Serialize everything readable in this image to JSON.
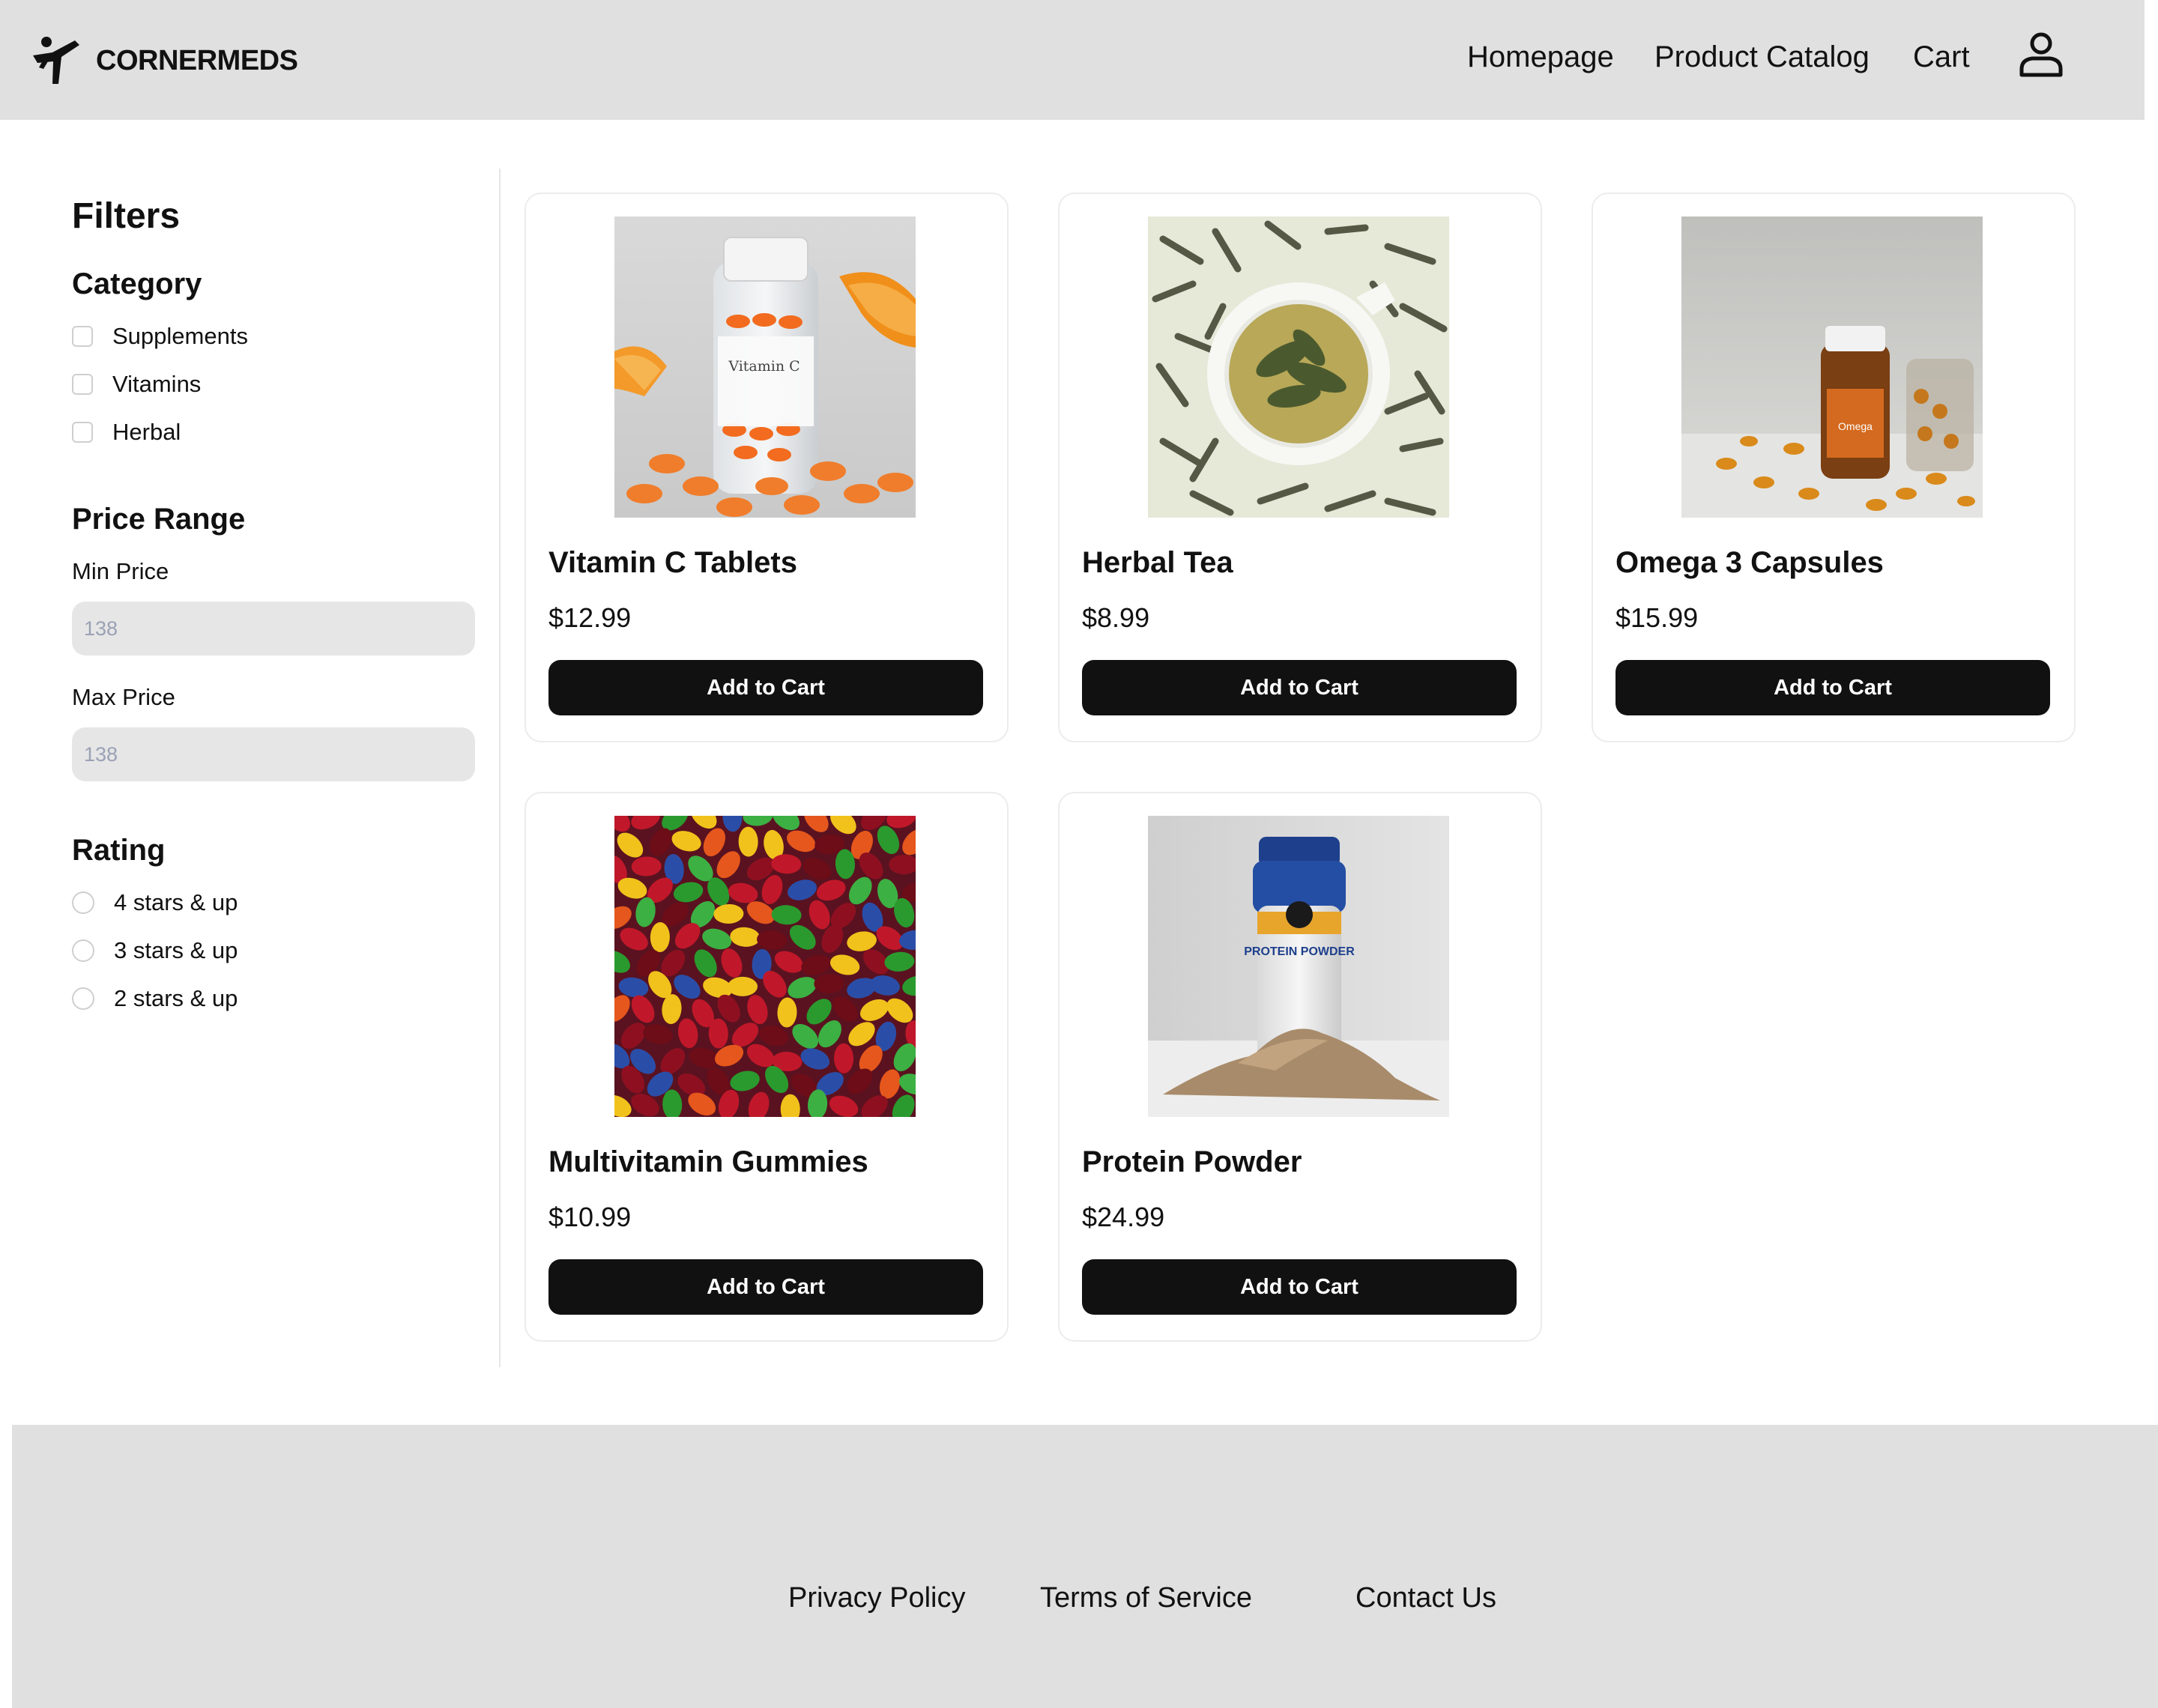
{
  "header": {
    "brand": "CORNERMEDS",
    "logo_icon": "runner-logo-icon",
    "nav": [
      "Homepage",
      "Product Catalog",
      "Cart"
    ],
    "user_icon": "user-icon"
  },
  "filters": {
    "title": "Filters",
    "category": {
      "title": "Category",
      "options": [
        "Supplements",
        "Vitamins",
        "Herbal"
      ]
    },
    "price_range": {
      "title": "Price Range",
      "min_label": "Min Price",
      "min_placeholder": "138",
      "max_label": "Max Price",
      "max_placeholder": "138"
    },
    "rating": {
      "title": "Rating",
      "options": [
        "4 stars & up",
        "3 stars & up",
        "2 stars & up"
      ]
    }
  },
  "products": [
    {
      "name": "Vitamin C Tablets",
      "price": "$12.99",
      "cta": "Add to Cart",
      "bottle_label": "Vitamin C"
    },
    {
      "name": "Herbal Tea",
      "price": "$8.99",
      "cta": "Add to Cart"
    },
    {
      "name": "Omega 3 Capsules",
      "price": "$15.99",
      "cta": "Add to Cart",
      "bottle_label": "Omega"
    },
    {
      "name": "Multivitamin Gummies",
      "price": "$10.99",
      "cta": "Add to Cart"
    },
    {
      "name": "Protein Powder",
      "price": "$24.99",
      "cta": "Add to Cart",
      "tub_label": "PROTEIN POWDER"
    }
  ],
  "footer": {
    "links": [
      "Privacy Policy",
      "Terms of Service",
      "Contact Us"
    ]
  },
  "colors": {
    "header_bg": "#e0e0e0",
    "footer_bg": "#e0e0e0",
    "button_bg": "#111111",
    "input_bg": "#e6e6e6"
  }
}
